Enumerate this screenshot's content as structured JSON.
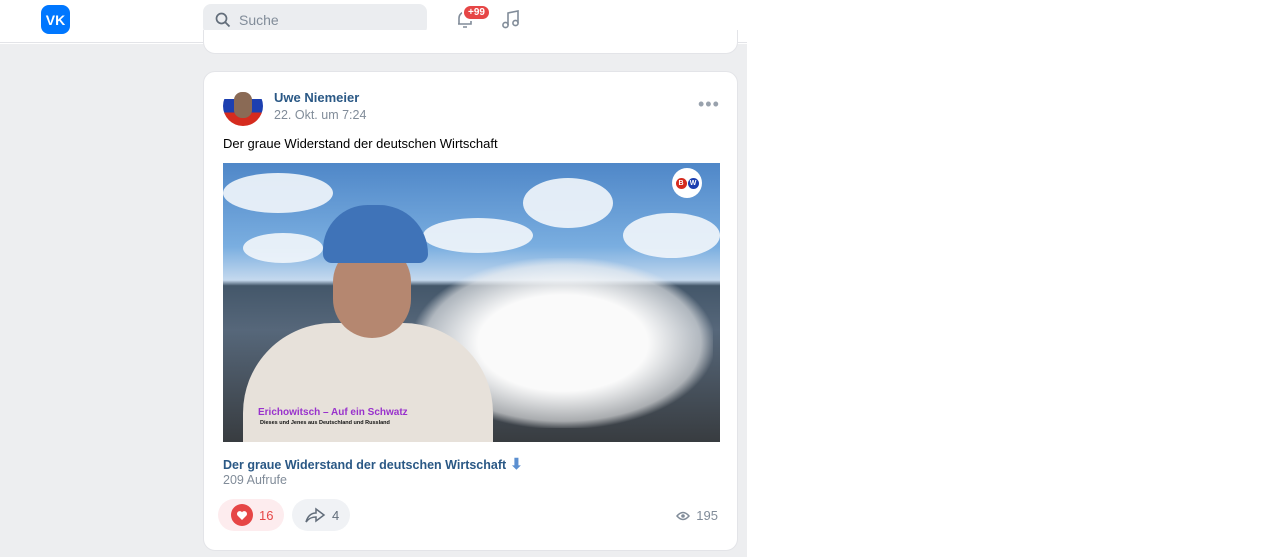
{
  "header": {
    "logo": "VK",
    "search_placeholder": "Suche",
    "notifications_badge": "+99"
  },
  "post": {
    "author": "Uwe Niemeier",
    "date": "22. Okt. um 7:24",
    "text": "Der graue Widerstand der deutschen Wirtschaft",
    "video": {
      "overlay_title": "Erichowitsch – Auf ein Schwatz",
      "overlay_subtitle": "Dieses und Jenes aus Deutschland und Russland",
      "badge_left": "B",
      "badge_right": "W",
      "title": "Der graue Widerstand der deutschen Wirtschaft",
      "views": "209 Aufrufe"
    },
    "likes": "16",
    "shares": "4",
    "views": "195"
  }
}
